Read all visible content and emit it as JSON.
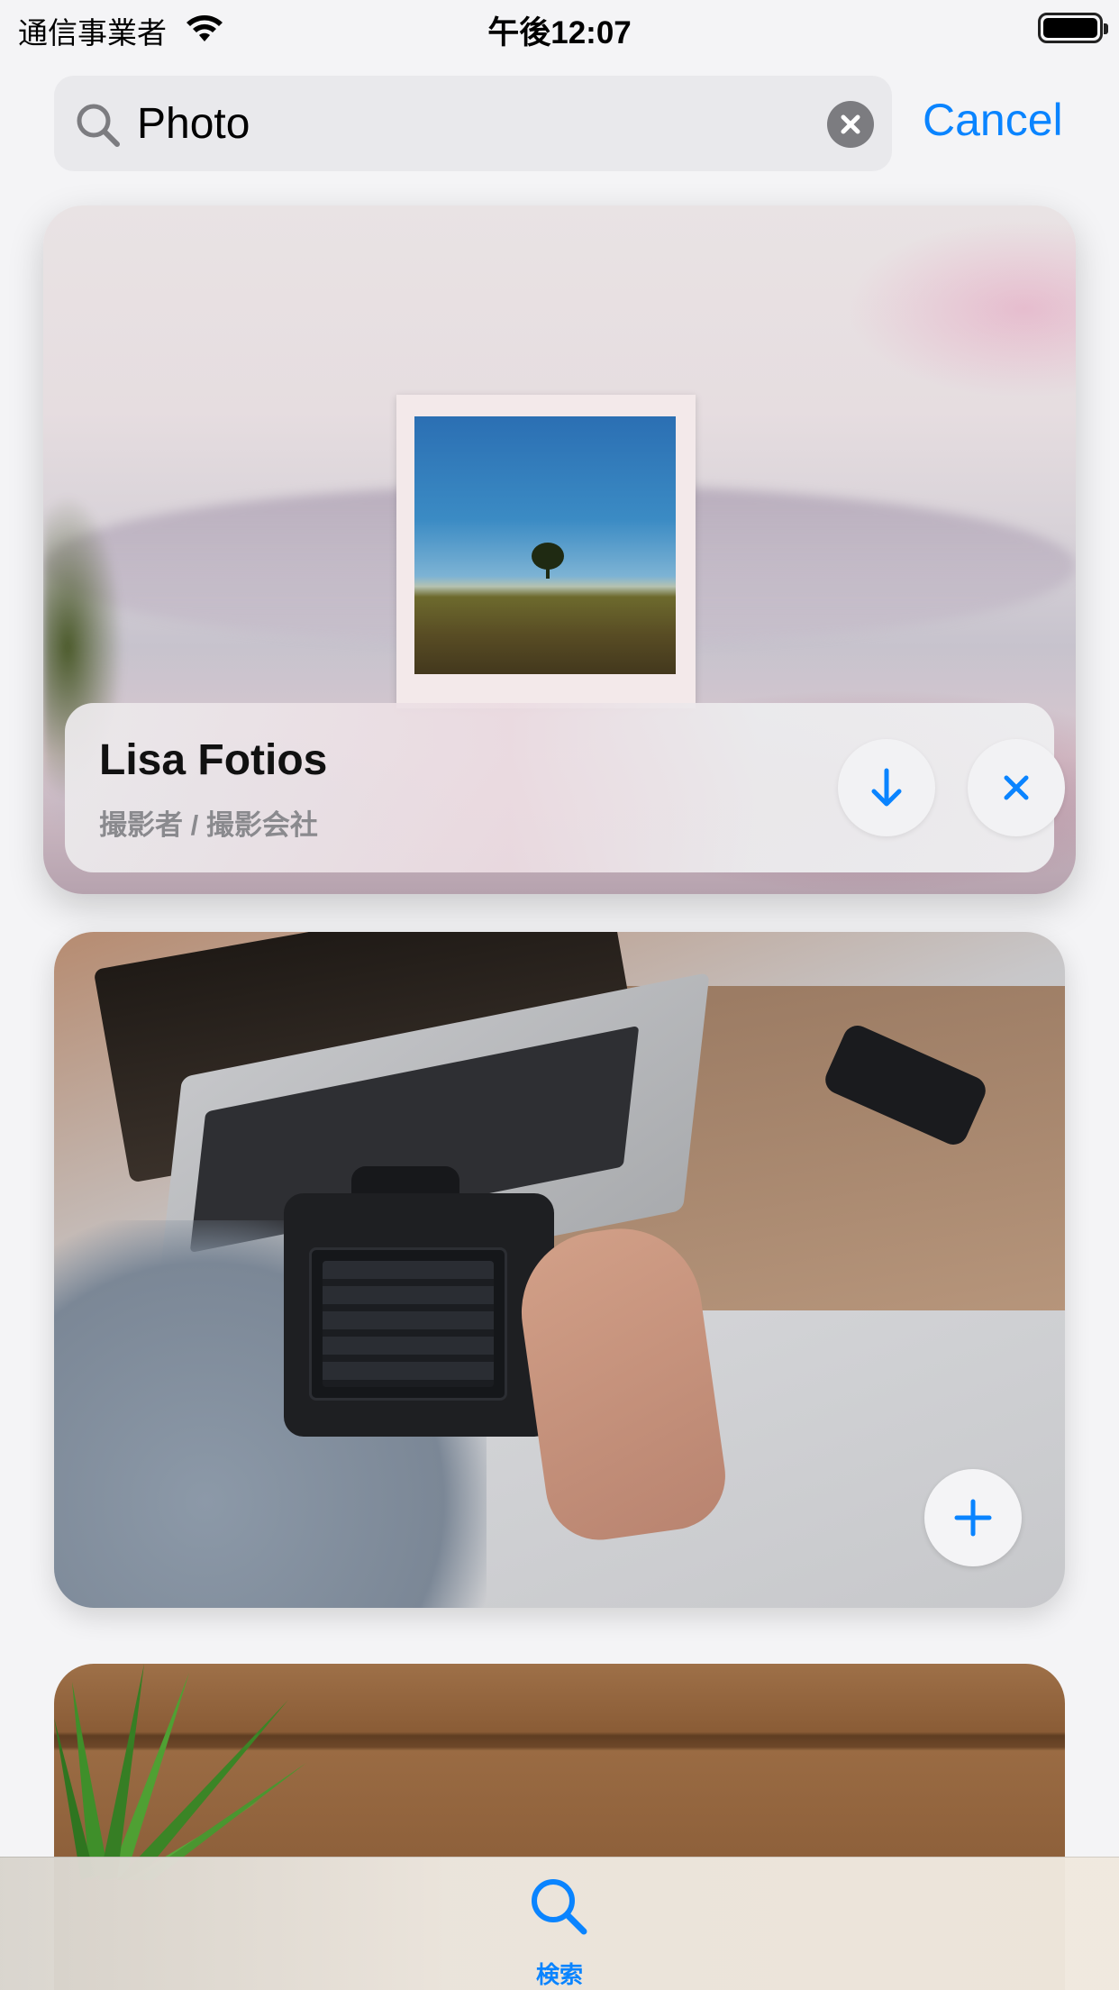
{
  "status_bar": {
    "carrier": "通信事業者",
    "time": "午後12:07"
  },
  "search": {
    "query": "Photo",
    "cancel_label": "Cancel"
  },
  "cards": [
    {
      "photographer": "Lisa Fotios",
      "role": "撮影者 / 撮影会社",
      "actions": [
        "download-icon",
        "close-icon"
      ]
    },
    {
      "actions": [
        "plus-icon"
      ]
    },
    {}
  ],
  "tab_bar": {
    "items": [
      {
        "label": "検索",
        "icon": "search-icon",
        "selected": true
      }
    ]
  },
  "colors": {
    "accent": "#0a84ff",
    "secondary_text": "#8a8a8e"
  }
}
